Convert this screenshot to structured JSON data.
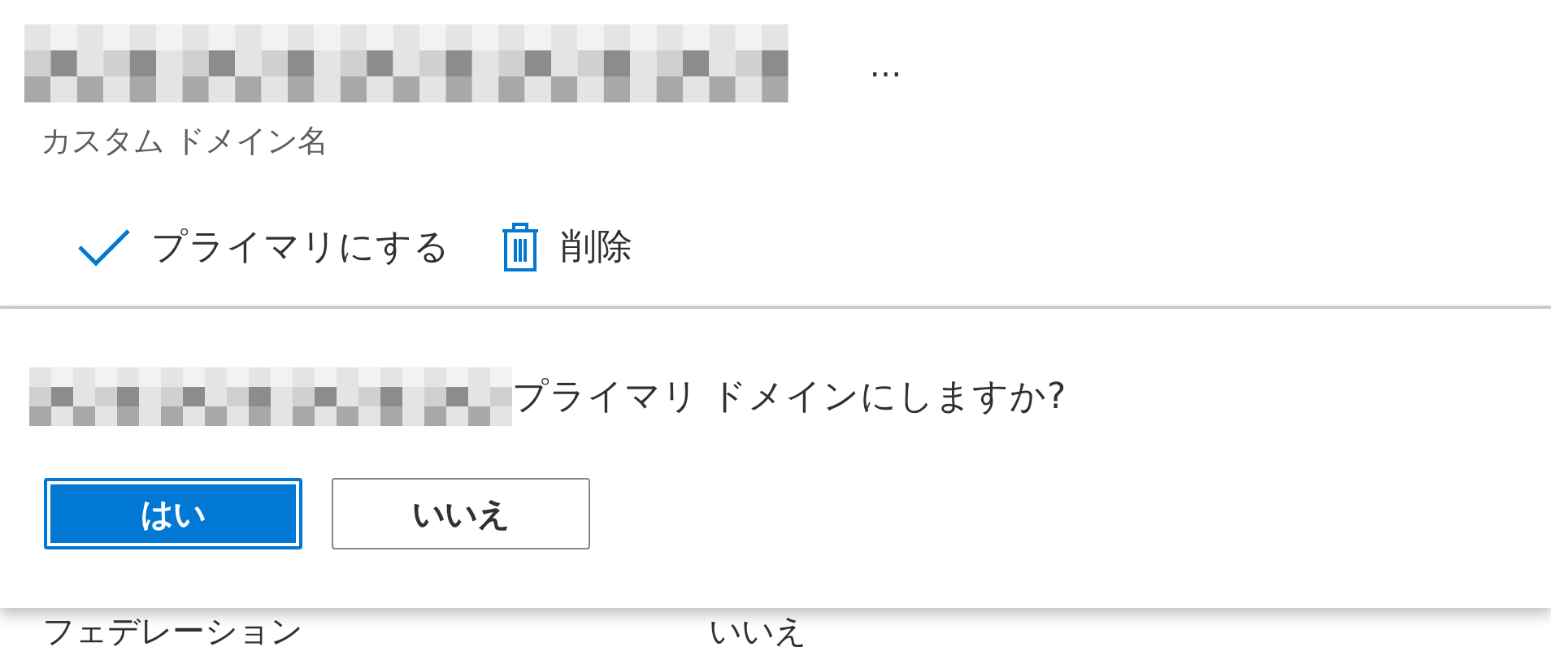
{
  "domain_header": {
    "more_button": "…",
    "subtitle": "カスタム ドメイン名"
  },
  "toolbar": [
    {
      "kind": "check",
      "label": "プライマリにする"
    },
    {
      "kind": "trash",
      "label": "削除"
    }
  ],
  "confirm_dialog": {
    "message": "プライマリ ドメインにしますか?",
    "buttons": [
      {
        "label": "はい",
        "primary": true
      },
      {
        "label": "いいえ",
        "primary": false
      }
    ]
  },
  "background_row": {
    "column_1": "フェデレーション",
    "column_2": "いいえ"
  }
}
